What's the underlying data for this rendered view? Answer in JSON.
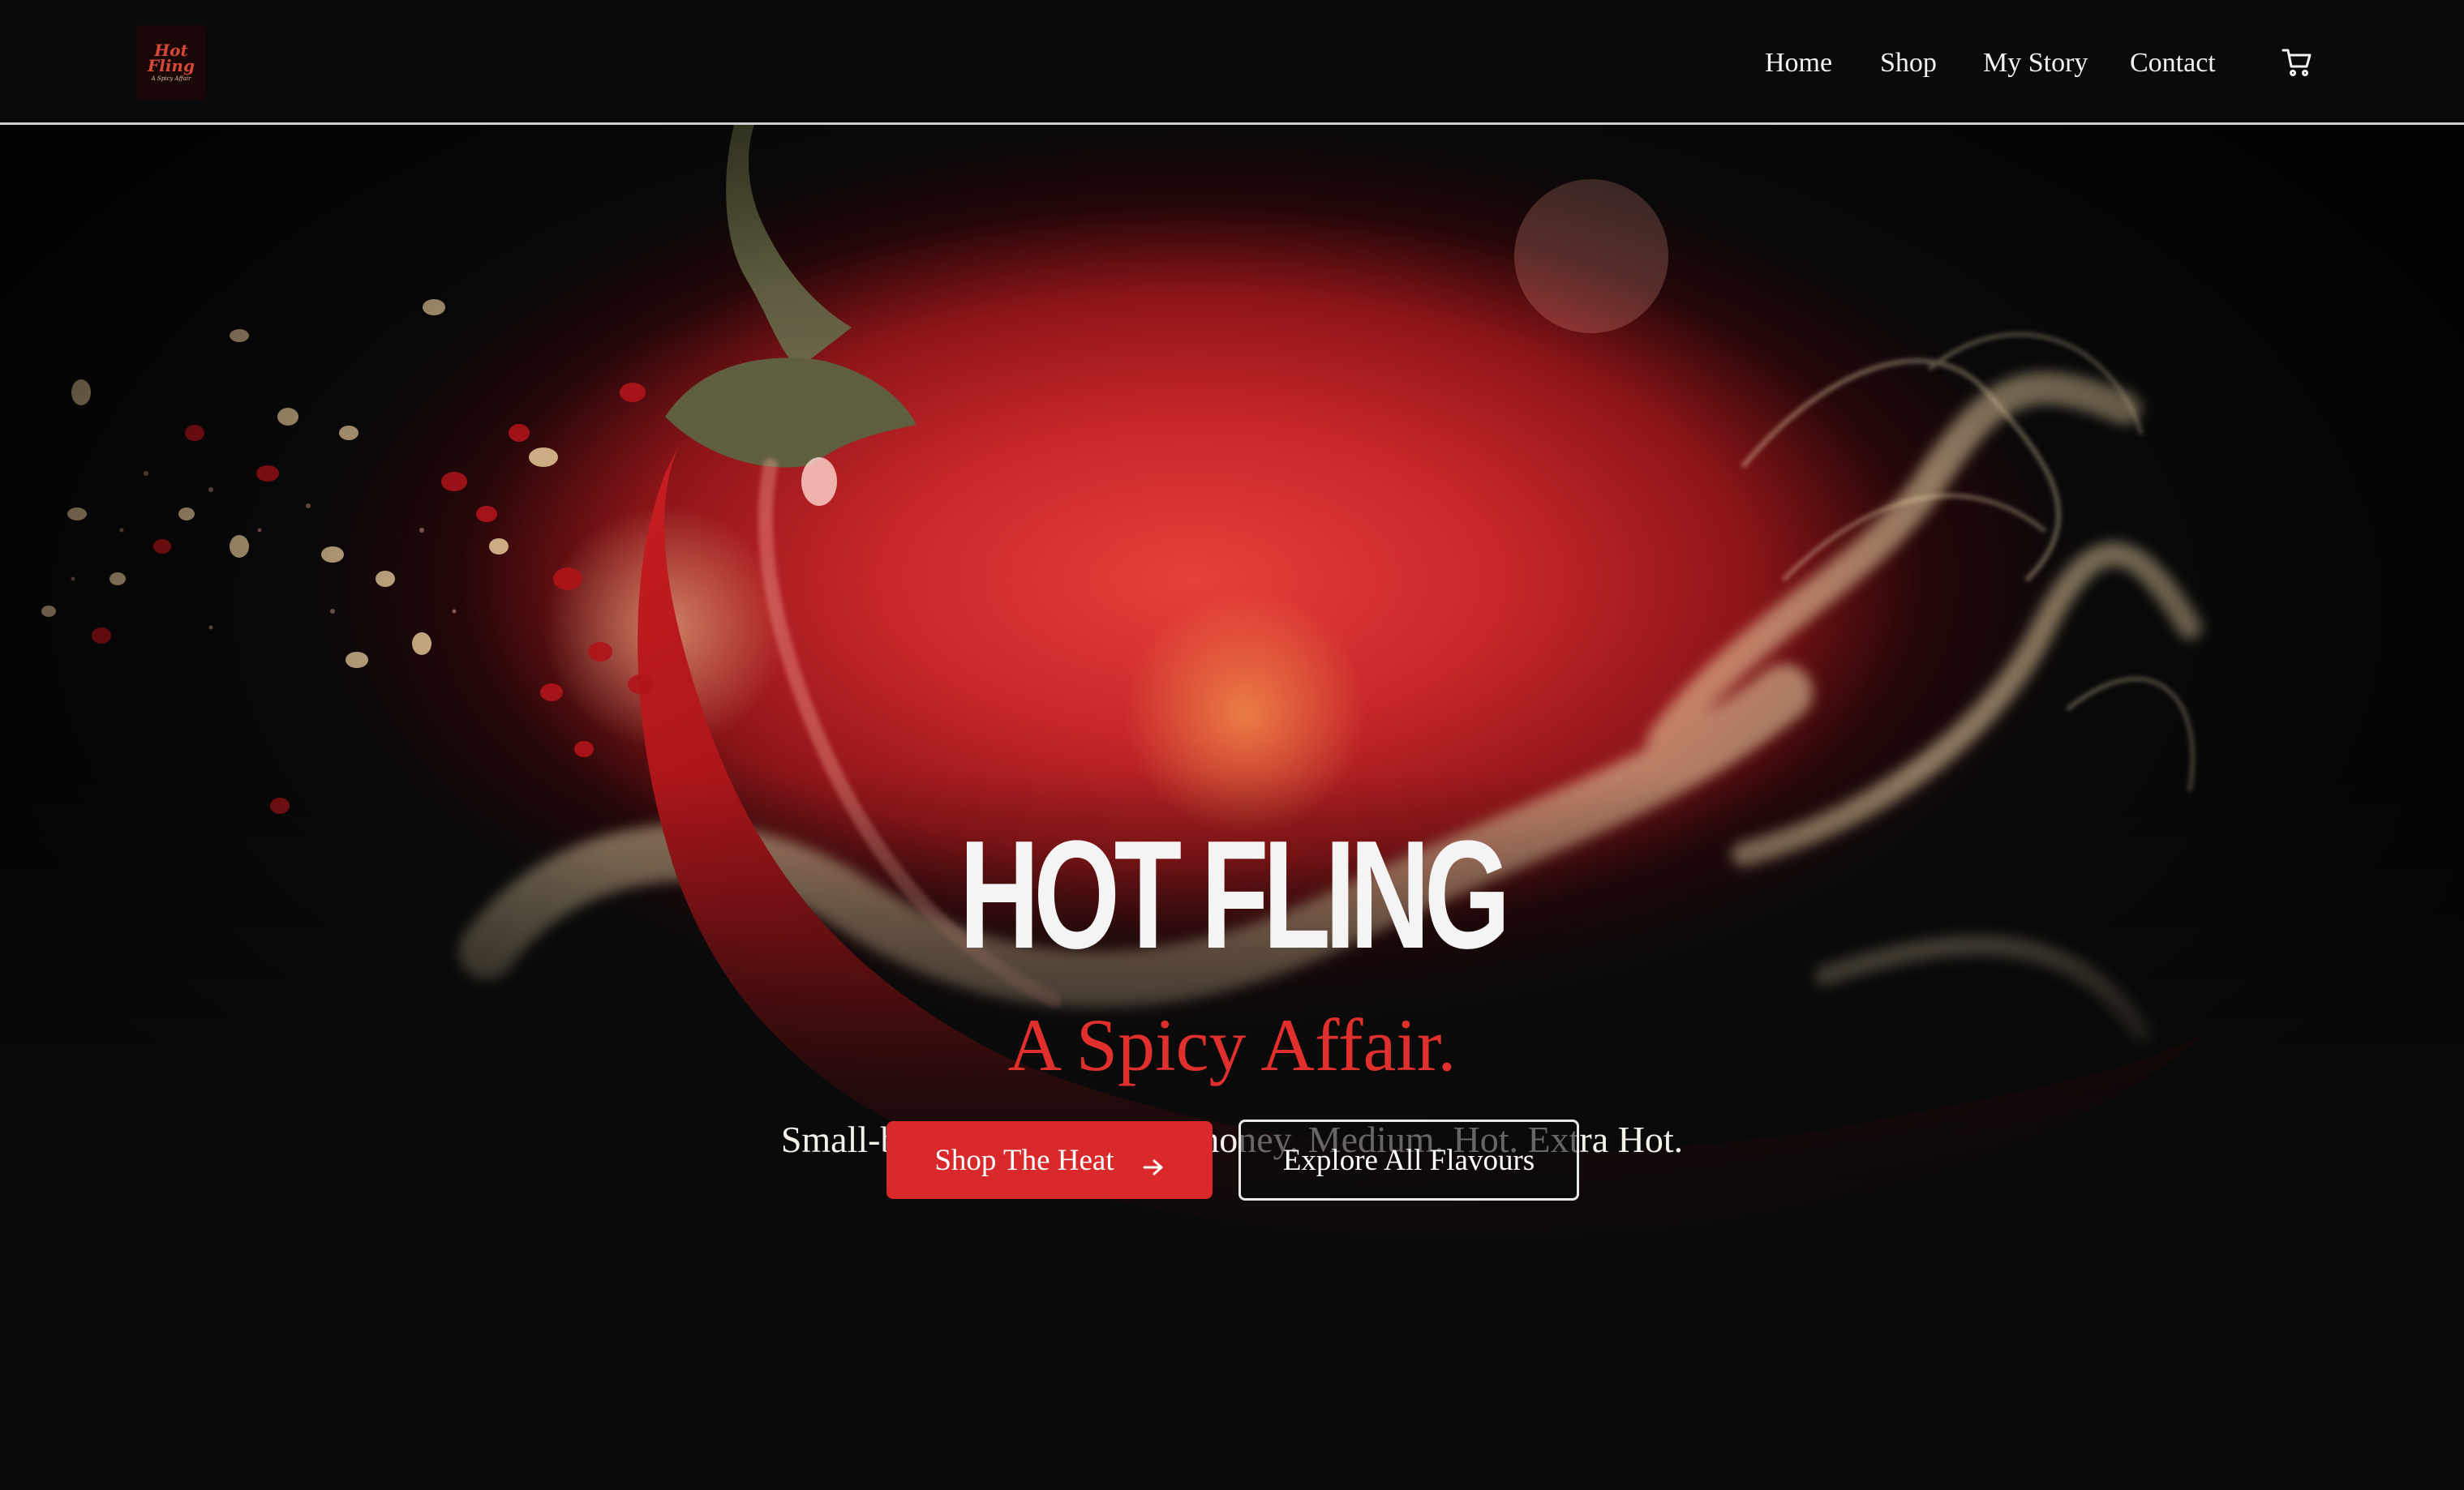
{
  "brand": {
    "logo_text": "Hot\nFling",
    "logo_subtext": "A Spicy Affair"
  },
  "nav": {
    "items": [
      {
        "label": "Home"
      },
      {
        "label": "Shop"
      },
      {
        "label": "My Story"
      },
      {
        "label": "Contact"
      }
    ],
    "cart_icon": "cart-icon"
  },
  "hero": {
    "title": "HOT FLING",
    "tagline": "A Spicy Affair.",
    "description": "Small-batch chilli oil & hot honey. Medium. Hot. Extra Hot.",
    "primary_cta": "Shop The Heat",
    "primary_cta_icon": "arrow-right-icon",
    "secondary_cta": "Explore All Flavours"
  },
  "colors": {
    "background": "#0a0a0a",
    "accent": "#d9292b",
    "tagline": "#e0302e",
    "text": "#f4f4f4"
  }
}
